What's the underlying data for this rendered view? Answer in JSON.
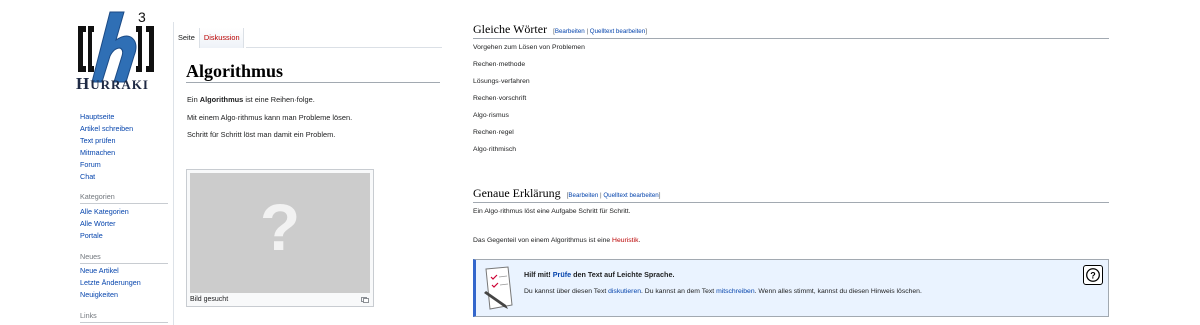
{
  "logo": {
    "big_letter": "H",
    "rest": "URRAKI",
    "superscript": "3"
  },
  "sidebar": {
    "main": [
      "Hauptseite",
      "Artikel schreiben",
      "Text prüfen",
      "Mitmachen",
      "Forum",
      "Chat"
    ],
    "kategorien_heading": "Kategorien",
    "kategorien": [
      "Alle Kategorien",
      "Alle Wörter",
      "Portale"
    ],
    "neues_heading": "Neues",
    "neues": [
      "Neue Artikel",
      "Letzte Änderungen",
      "Neuigkeiten"
    ],
    "links_heading": "Links"
  },
  "tabs": {
    "seite": "Seite",
    "diskussion": "Diskussion"
  },
  "article": {
    "title": "Algorithmus",
    "intro_prefix": "Ein ",
    "intro_bold": "Algorithmus",
    "intro_suffix": " ist eine Reihen·folge.",
    "line2": "Mit einem Algo·rithmus kann man Probleme lösen.",
    "line3": "Schritt für Schritt löst man damit ein Problem.",
    "thumb_symbol": "?",
    "thumb_caption": "Bild gesucht"
  },
  "section1": {
    "heading": "Gleiche Wörter",
    "edit_open": "[",
    "edit": "Bearbeiten",
    "sep": " | ",
    "edit_source": "Quelltext bearbeiten",
    "edit_close": "]",
    "items": [
      "Vorgehen zum Lösen von Problemen",
      "Rechen·methode",
      "Lösungs·verfahren",
      "Rechen·vorschrift",
      "Algo·rismus",
      "Rechen·regel",
      "Algo·rithmisch"
    ]
  },
  "section2": {
    "heading": "Genaue Erklärung",
    "edit_open": "[",
    "edit": "Bearbeiten",
    "sep": " | ",
    "edit_source": "Quelltext bearbeiten",
    "edit_close": "]",
    "line1": "Ein Algo·rithmus löst eine Aufgabe Schritt für Schritt.",
    "line2_prefix": "Das Gegenteil von einem Algorithmus ist eine ",
    "line2_link": "Heuristik",
    "line2_suffix": "."
  },
  "notice": {
    "title_prefix": "Hilf mit! ",
    "title_link": "Prüfe",
    "title_suffix": " den Text auf Leichte Sprache.",
    "text_a": "Du kannst über diesen Text ",
    "link_a": "diskutieren",
    "text_b": ". Du kannst an dem Text ",
    "link_b": "mitschreiben",
    "text_c": ". Wenn alles stimmt, kannst du diesen Hinweis löschen.",
    "help_symbol": "?"
  },
  "colors": {
    "link": "#0645ad",
    "redlink": "#ba0000",
    "notice_bg": "#eaf3ff",
    "notice_accent": "#3366cc"
  }
}
